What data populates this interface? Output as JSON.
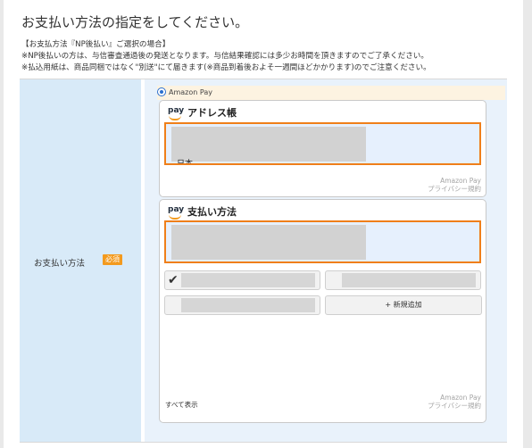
{
  "page": {
    "title": "お支払い方法の指定をしてください。",
    "notes": [
      "【お支払方法『NP後払い』ご選択の場合】",
      "※NP後払いの方は、与信審査通過後の発送となります。与信結果確認には多少お時間を頂きますのでご了承ください。",
      "※払込用紙は、商品同梱ではなく\"別送\"にて届きます(※商品到着後およそ一週間ほどかかります)のでご注意ください。"
    ]
  },
  "form": {
    "row_label": "お支払い方法",
    "required_badge": "必須",
    "option_label": "Amazon Pay"
  },
  "address_widget": {
    "logo": "pay",
    "title": "アドレス帳",
    "country": "日本",
    "brand": "Amazon Pay",
    "privacy": "プライバシー規約"
  },
  "payment_widget": {
    "logo": "pay",
    "title": "支払い方法",
    "add_button": "+ 新規追加",
    "show_all": "すべて表示",
    "brand": "Amazon Pay",
    "privacy": "プライバシー規約",
    "check_glyph": "✔"
  },
  "colors": {
    "accent_orange": "#ef7f1a",
    "label_cell_bg": "#d8eaf8",
    "radio_blue": "#2b6fcf"
  }
}
